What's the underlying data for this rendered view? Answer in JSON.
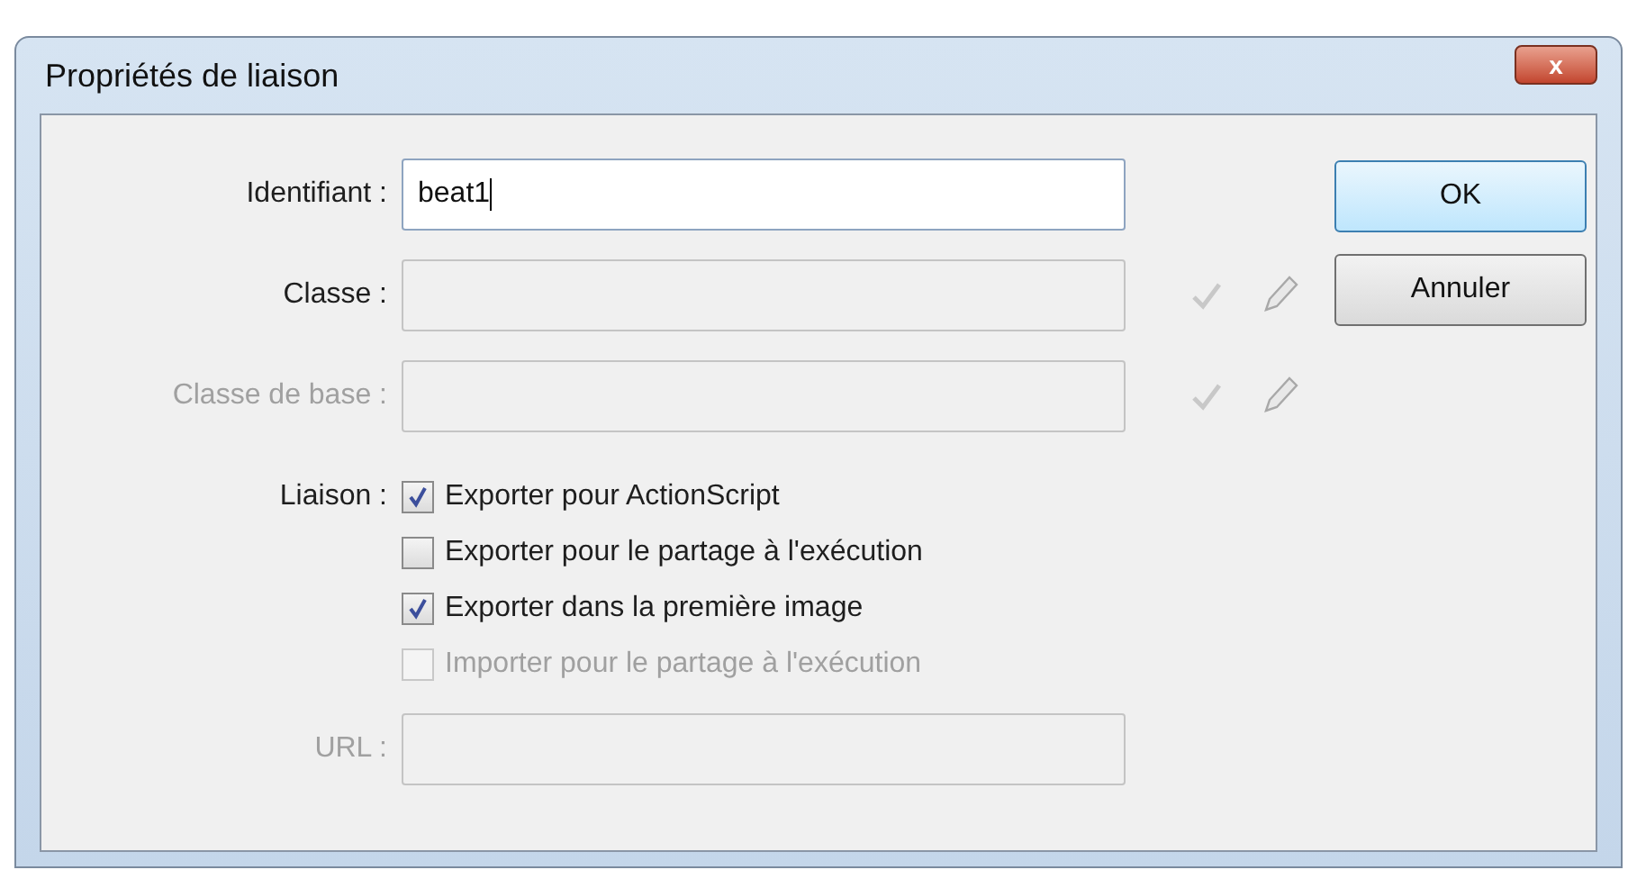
{
  "window": {
    "title": "Propriétés de liaison",
    "close": "x"
  },
  "fields": [
    {
      "label": "Identifiant :",
      "value": "beat1",
      "kind": "editable",
      "actions": false
    },
    {
      "label": "Classe :",
      "kind": "readonly",
      "actions": true
    },
    {
      "label": "Classe de base :",
      "kind": "disabled",
      "actions": true
    }
  ],
  "linkage": {
    "label": "Liaison :",
    "options": [
      {
        "label": "Exporter pour ActionScript",
        "checked": true,
        "disabled": false
      },
      {
        "label": "Exporter pour le partage à l'exécution",
        "checked": false,
        "disabled": false
      },
      {
        "label": "Exporter dans la première image",
        "checked": true,
        "disabled": false
      },
      {
        "label": "Importer pour le partage à l'exécution",
        "checked": false,
        "disabled": true
      }
    ]
  },
  "url": {
    "label": "URL :",
    "kind": "disabled"
  },
  "buttons": [
    {
      "label": "OK",
      "default": true
    },
    {
      "label": "Annuler",
      "default": false
    }
  ]
}
